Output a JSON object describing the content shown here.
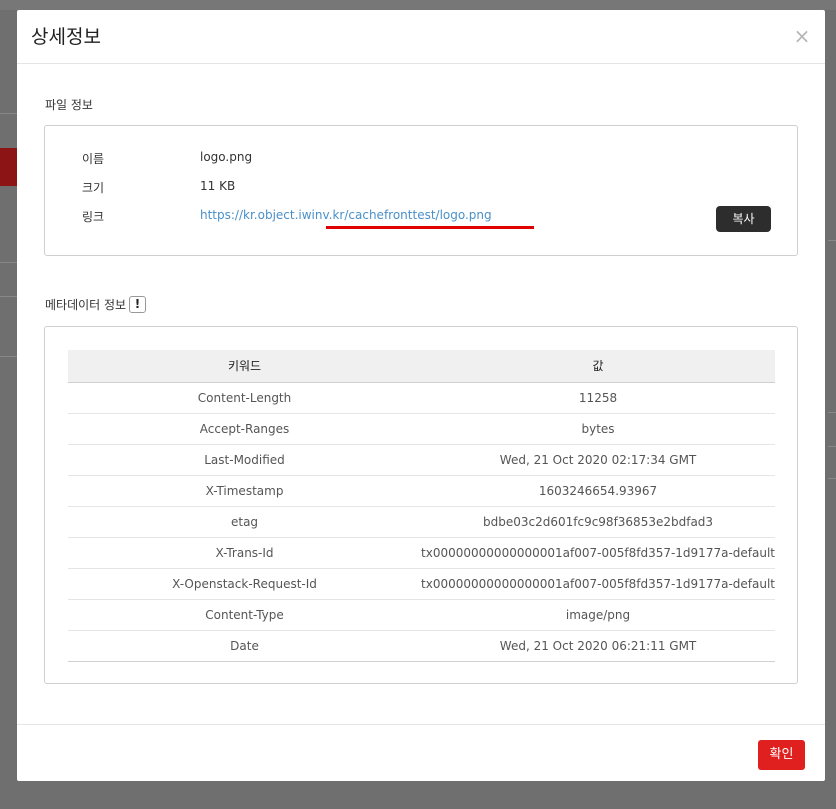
{
  "modal": {
    "title": "상세정보",
    "close_symbol": "×",
    "file_section": {
      "title": "파일 정보",
      "name_label": "이름",
      "name_value": "logo.png",
      "size_label": "크기",
      "size_value": "11 KB",
      "link_label": "링크",
      "link_value": "https://kr.object.iwinv.kr/cachefronttest/logo.png",
      "copy_label": "복사"
    },
    "meta_section": {
      "title": "메타데이터 정보",
      "info_icon_symbol": "!",
      "headers": {
        "key": "키워드",
        "value": "값"
      },
      "rows": [
        {
          "key": "Content-Length",
          "value": "11258"
        },
        {
          "key": "Accept-Ranges",
          "value": "bytes"
        },
        {
          "key": "Last-Modified",
          "value": "Wed, 21 Oct 2020 02:17:34 GMT"
        },
        {
          "key": "X-Timestamp",
          "value": "1603246654.93967"
        },
        {
          "key": "etag",
          "value": "bdbe03c2d601fc9c98f36853e2bdfad3"
        },
        {
          "key": "X-Trans-Id",
          "value": "tx00000000000000001af007-005f8fd357-1d9177a-default"
        },
        {
          "key": "X-Openstack-Request-Id",
          "value": "tx00000000000000001af007-005f8fd357-1d9177a-default"
        },
        {
          "key": "Content-Type",
          "value": "image/png"
        },
        {
          "key": "Date",
          "value": "Wed, 21 Oct 2020 06:21:11 GMT"
        }
      ]
    },
    "footer": {
      "confirm_label": "확인"
    }
  },
  "colors": {
    "confirm_button": "#e0201f",
    "copy_button": "#2d2d2d",
    "link": "#4a90c9",
    "highlight_underline": "#e10000"
  }
}
